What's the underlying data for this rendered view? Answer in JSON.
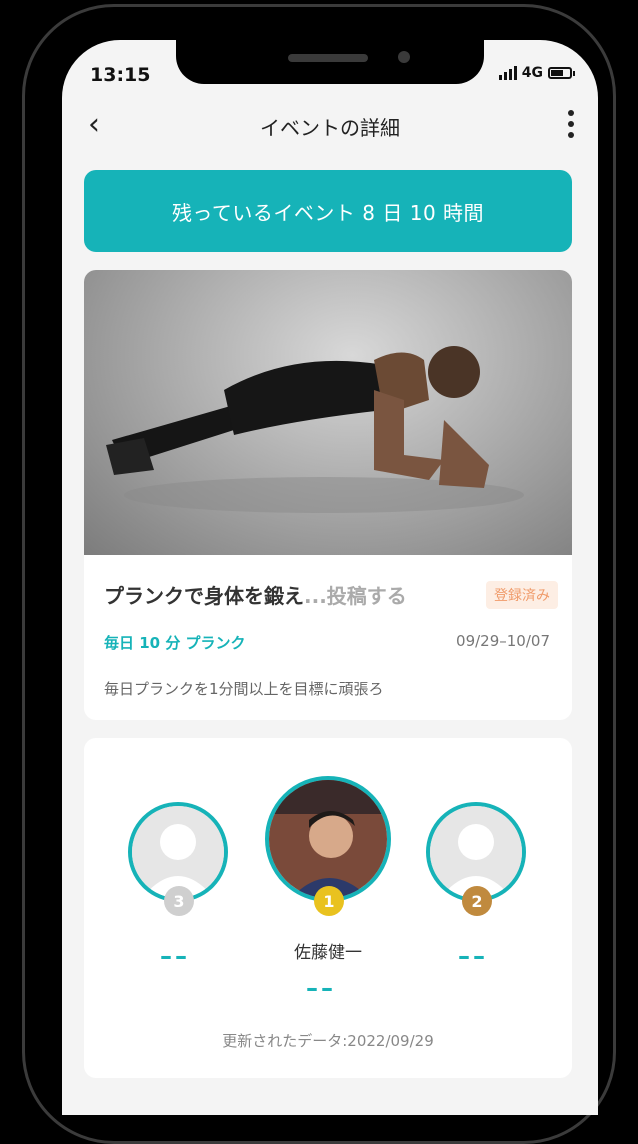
{
  "status": {
    "time": "13:15",
    "network": "4G"
  },
  "header": {
    "title": "イベントの詳細"
  },
  "countdown": {
    "text": "残っているイベント 8 日 10 時間"
  },
  "event": {
    "title": "プランクで身体を鍛え",
    "title_truncated": "...投稿する",
    "badge": "登録済み",
    "tag": "毎日 10 分 プランク",
    "dates": "09/29–10/07",
    "description": "毎日プランクを1分間以上を目標に頑張ろ"
  },
  "ranking": {
    "first": {
      "rank": "1",
      "name": "佐藤健一",
      "score": "––"
    },
    "second": {
      "rank": "2",
      "score": "––"
    },
    "third": {
      "rank": "3",
      "score": "––"
    },
    "updated": "更新されたデータ:2022/09/29"
  },
  "colors": {
    "accent": "#16b3b8",
    "badge_text": "#f09b6a",
    "gold": "#e9c21f",
    "bronze": "#c08a3e",
    "silver": "#cfcfcf"
  }
}
